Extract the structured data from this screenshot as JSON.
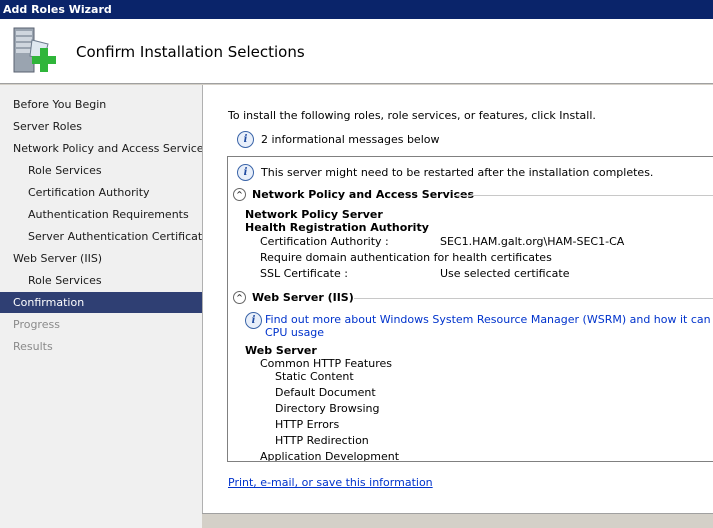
{
  "window": {
    "title": "Add Roles Wizard"
  },
  "header": {
    "title": "Confirm Installation Selections",
    "icon": "server-roles-add-icon"
  },
  "nav": [
    {
      "label": "Before You Begin",
      "level": "top",
      "state": "normal"
    },
    {
      "label": "Server Roles",
      "level": "top",
      "state": "normal"
    },
    {
      "label": "Network Policy and Access Services",
      "level": "top",
      "state": "normal"
    },
    {
      "label": "Role Services",
      "level": "sub",
      "state": "normal"
    },
    {
      "label": "Certification Authority",
      "level": "sub",
      "state": "normal"
    },
    {
      "label": "Authentication Requirements",
      "level": "sub",
      "state": "normal"
    },
    {
      "label": "Server Authentication Certificate",
      "level": "sub",
      "state": "normal"
    },
    {
      "label": "Web Server (IIS)",
      "level": "top",
      "state": "normal"
    },
    {
      "label": "Role Services",
      "level": "sub",
      "state": "normal"
    },
    {
      "label": "Confirmation",
      "level": "top",
      "state": "active"
    },
    {
      "label": "Progress",
      "level": "top",
      "state": "disabled"
    },
    {
      "label": "Results",
      "level": "top",
      "state": "disabled"
    }
  ],
  "main": {
    "instruction": "To install the following roles, role services, or features, click Install.",
    "info_summary": "2 informational messages below",
    "restart_note": "This server might need to be restarted after the installation completes.",
    "npas": {
      "title": "Network Policy and Access Services",
      "service1": "Network Policy Server",
      "service2": "Health Registration Authority",
      "ca_label": "Certification Authority :",
      "ca_value": "SEC1.HAM.galt.org\\HAM-SEC1-CA",
      "domain_auth": "Require domain authentication for health certificates",
      "ssl_label": "SSL Certificate :",
      "ssl_value": "Use selected certificate"
    },
    "iis": {
      "title": "Web Server (IIS)",
      "wsrm_link_line1": "Find out more about Windows System Resource Manager (WSRM) and how it can help optimiz",
      "wsrm_link_line2": "CPU usage",
      "web_server": "Web Server",
      "common_http": "Common HTTP Features",
      "static_content": "Static Content",
      "default_document": "Default Document",
      "directory_browsing": "Directory Browsing",
      "http_errors": "HTTP Errors",
      "http_redirection": "HTTP Redirection",
      "app_dev": "Application Development"
    },
    "print_link": "Print, e-mail, or save this information"
  }
}
